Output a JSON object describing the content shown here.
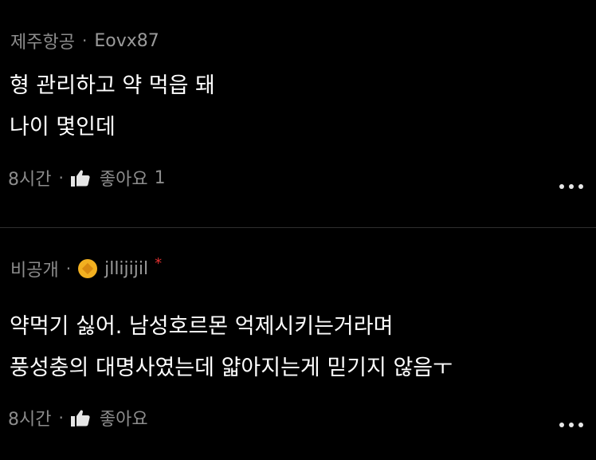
{
  "comments": [
    {
      "affiliation": "제주항공",
      "username": "Eovx87",
      "lines": [
        "형 관리하고 약 먹읍 돼",
        "나이 몇인데"
      ],
      "time": "8시간",
      "like_label": "좋아요",
      "like_count": "1"
    },
    {
      "affiliation": "비공개",
      "username": "jllijijil",
      "author_mark": "*",
      "lines": [
        "약먹기 싫어. 남성호르몬 억제시키는거라며",
        "풍성충의 대명사였는데 얇아지는게 믿기지 않음ㅜ"
      ],
      "time": "8시간",
      "like_label": "좋아요"
    }
  ],
  "separator": "·",
  "icons": {
    "like": "thumbs-up-icon",
    "more": "more-horizontal-icon",
    "avatar": "gold-badge-avatar"
  },
  "colors": {
    "background": "#000000",
    "text": "#ffffff",
    "muted": "#8c8c8c",
    "avatar": "#f2b020",
    "asterisk": "#e03030"
  }
}
